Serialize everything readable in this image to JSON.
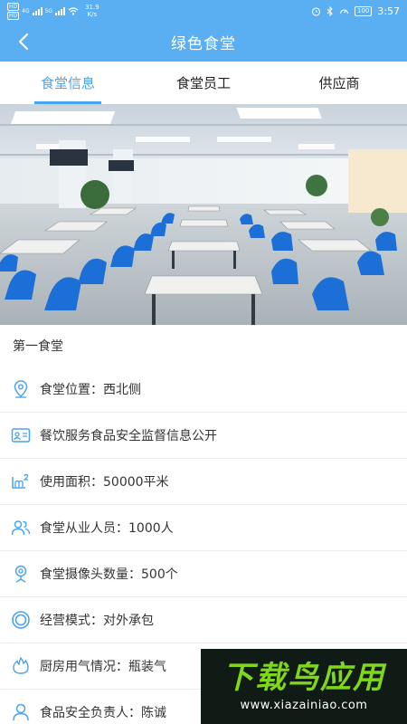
{
  "status_bar": {
    "badge_top": "HD",
    "badge_bottom": "HD",
    "net_a": "4G",
    "net_b": "5G",
    "speed_value": "31.9",
    "speed_unit": "K/s",
    "battery": "100",
    "time": "3:57",
    "icons": [
      "alarm-icon",
      "bluetooth-icon",
      "speedometer-icon",
      "battery-icon"
    ]
  },
  "header": {
    "title": "绿色食堂",
    "back_icon": "chevron-left-icon"
  },
  "tabs": [
    {
      "label": "食堂信息",
      "active": true
    },
    {
      "label": "食堂员工",
      "active": false
    },
    {
      "label": "供应商",
      "active": false
    }
  ],
  "colors": {
    "accent": "#5aaef2",
    "tab_active": "#4aa3ee",
    "icon": "#4aa3ee",
    "watermark_green": "#7fd61a"
  },
  "canteen": {
    "name": "第一食堂",
    "items": [
      {
        "icon": "location-pin-icon",
        "text": "食堂位置：西北侧"
      },
      {
        "icon": "id-card-icon",
        "text": "餐饮服务食品安全监督信息公开"
      },
      {
        "icon": "area-m2-icon",
        "text": "使用面积：50000平米"
      },
      {
        "icon": "users-icon",
        "text": "食堂从业人员：1000人"
      },
      {
        "icon": "camera-icon",
        "text": "食堂摄像头数量：500个"
      },
      {
        "icon": "ring-icon",
        "text": "经营模式：对外承包"
      },
      {
        "icon": "flame-icon",
        "text": "厨房用气情况：瓶装气"
      },
      {
        "icon": "person-icon",
        "text": "食品安全负责人：陈诚"
      }
    ]
  },
  "watermark": {
    "title": "下载鸟应用",
    "url": "www.xiazainiao.com"
  }
}
